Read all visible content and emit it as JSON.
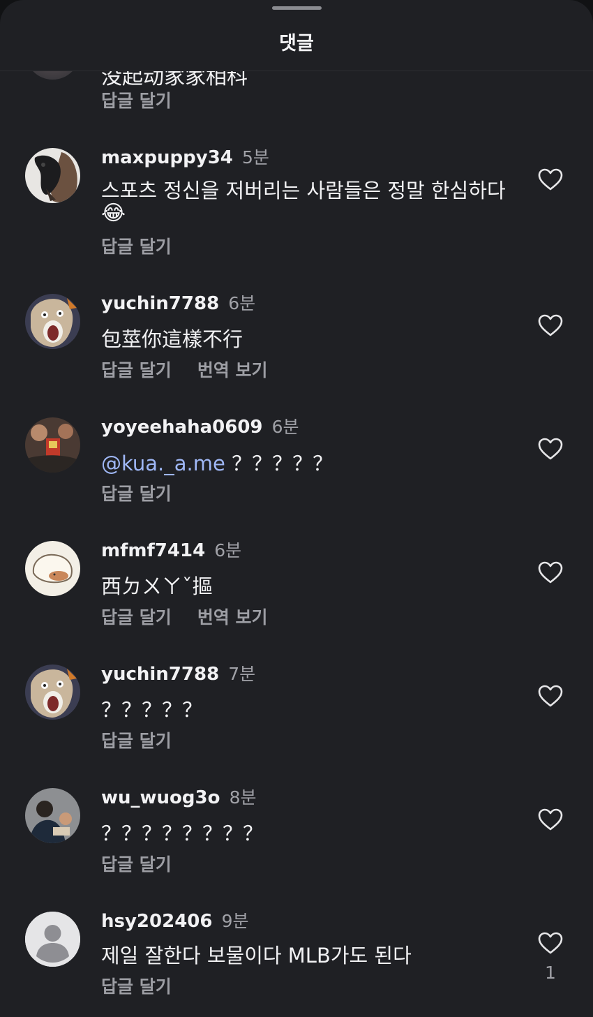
{
  "sheet": {
    "title": "댓글"
  },
  "partial_comment": {
    "text": "没起动家家相科",
    "reply_label": "답글 달기"
  },
  "comments": [
    {
      "username": "maxpuppy34",
      "time": "5분",
      "text": "스포츠 정신을 저버리는 사람들은 정말 한심하다",
      "emoji": "😂",
      "reply_label": "답글 달기",
      "avatar": "dog-photo-avatar"
    },
    {
      "username": "yuchin7788",
      "time": "6분",
      "text": "包莖你這樣不行",
      "reply_label": "답글 달기",
      "translate_label": "번역 보기",
      "avatar": "cartoon-face-avatar"
    },
    {
      "username": "yoyeehaha0609",
      "time": "6분",
      "mention": "@kua._a.me",
      "text": "？？？？？",
      "reply_label": "답글 달기",
      "avatar": "crowd-photo-avatar"
    },
    {
      "username": "mfmf7414",
      "time": "6분",
      "text": "西ㄉㄨㄚˇ摳",
      "reply_label": "답글 달기",
      "translate_label": "번역 보기",
      "avatar": "bread-drawing-avatar"
    },
    {
      "username": "yuchin7788",
      "time": "7분",
      "text": "？？？？？",
      "reply_label": "답글 달기",
      "avatar": "cartoon-face-avatar"
    },
    {
      "username": "wu_wuog3o",
      "time": "8분",
      "text": "？？？？？？？？",
      "reply_label": "답글 달기",
      "avatar": "people-photo-avatar"
    },
    {
      "username": "hsy202406",
      "time": "9분",
      "text": "제일 잘한다  보물이다 MLB가도 된다",
      "reply_label": "답글 달기",
      "avatar": "default-user-avatar",
      "like_count": "1"
    }
  ],
  "colors": {
    "sheet_bg": "#1f2024",
    "text": "#f2f2f4",
    "muted": "#9d9ea4",
    "mention": "#9fb7f5"
  }
}
